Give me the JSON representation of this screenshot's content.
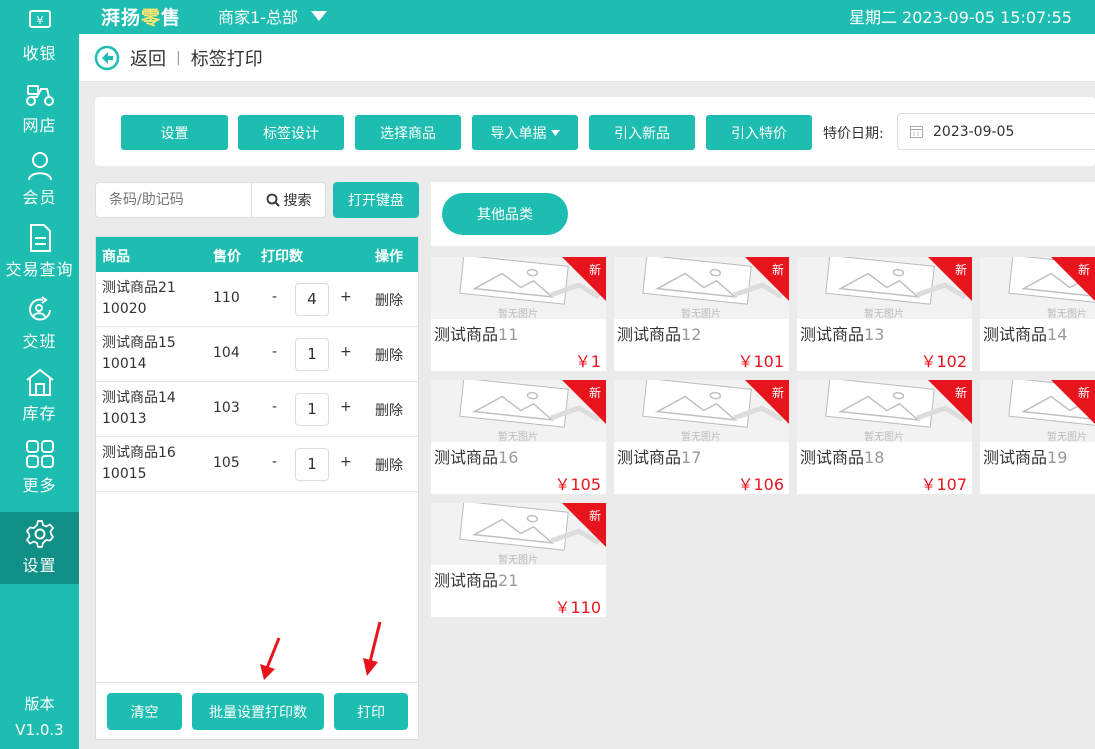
{
  "sidebar": {
    "items": [
      {
        "label": "收银",
        "icon": "cash-register-icon"
      },
      {
        "label": "网店",
        "icon": "scooter-icon"
      },
      {
        "label": "会员",
        "icon": "user-icon"
      },
      {
        "label": "交易查询",
        "icon": "document-icon"
      },
      {
        "label": "交班",
        "icon": "shift-handover-icon"
      },
      {
        "label": "库存",
        "icon": "warehouse-icon"
      },
      {
        "label": "更多",
        "icon": "grid-icon"
      },
      {
        "label": "设置",
        "icon": "gear-icon"
      }
    ],
    "active": "设置",
    "version_label": "版本",
    "version_value": "V1.0.3"
  },
  "topbar": {
    "brand_prefix": "湃扬",
    "brand_highlight": "零",
    "brand_suffix": "售",
    "store": "商家1-总部",
    "datetime": "星期二 2023-09-05 15:07:55"
  },
  "breadcrumb": {
    "back_label": "返回",
    "separator": "|",
    "title": "标签打印"
  },
  "toolbar": {
    "buttons": [
      "设置",
      "标签设计",
      "选择商品",
      "导入单据",
      "引入新品",
      "引入特价"
    ],
    "date_label": "特价日期:",
    "date_value": "2023-09-05"
  },
  "search": {
    "placeholder": "条码/助记码",
    "search_label": "搜索",
    "keyboard_label": "打开键盘"
  },
  "cart": {
    "headers": [
      "商品",
      "售价",
      "打印数",
      "操作"
    ],
    "minus": "-",
    "plus": "+",
    "delete_label": "删除",
    "rows": [
      {
        "name": "测试商品21",
        "code": "10020",
        "price": "110",
        "qty": "4"
      },
      {
        "name": "测试商品15",
        "code": "10014",
        "price": "104",
        "qty": "1"
      },
      {
        "name": "测试商品14",
        "code": "10013",
        "price": "103",
        "qty": "1"
      },
      {
        "name": "测试商品16",
        "code": "10015",
        "price": "105",
        "qty": "1"
      }
    ],
    "footer": {
      "clear_label": "清空",
      "batch_label": "批量设置打印数",
      "print_label": "打印"
    }
  },
  "category": {
    "label": "其他品类"
  },
  "products": {
    "badge": "新",
    "name_prefix": "测试商品",
    "placeholder_caption": "暂无图片",
    "items": [
      {
        "num": "11",
        "price": "￥1"
      },
      {
        "num": "12",
        "price": "￥101"
      },
      {
        "num": "13",
        "price": "￥102"
      },
      {
        "num": "14",
        "price": ""
      },
      {
        "num": "16",
        "price": "￥105"
      },
      {
        "num": "17",
        "price": "￥106"
      },
      {
        "num": "18",
        "price": "￥107"
      },
      {
        "num": "19",
        "price": ""
      },
      {
        "num": "21",
        "price": "￥110"
      }
    ]
  },
  "colors": {
    "accent": "#1ebdb1",
    "accent_dark": "#0f8f86",
    "badge": "#e8141d",
    "price": "#e8141d"
  }
}
